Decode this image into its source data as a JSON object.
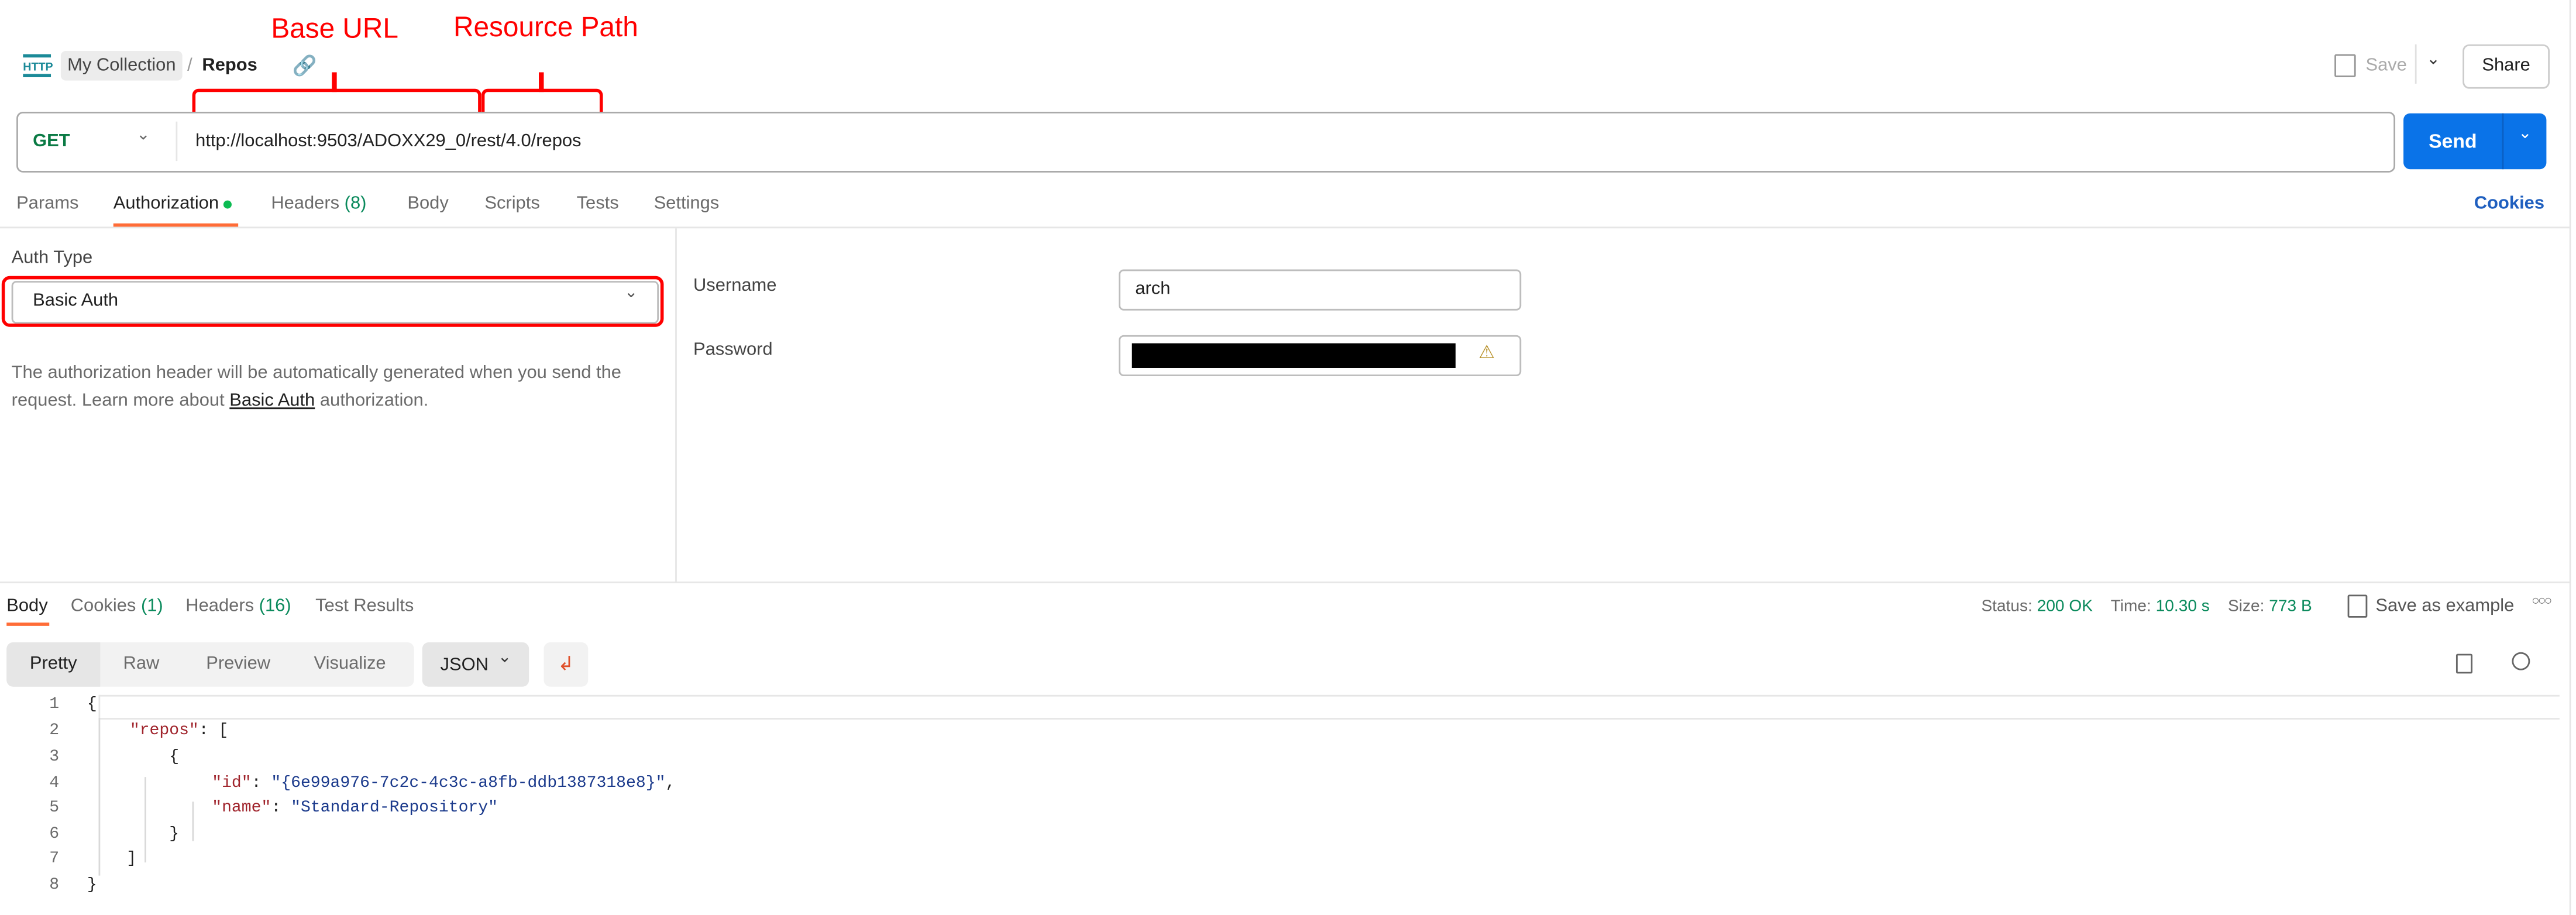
{
  "annotations": {
    "base_url": "Base URL",
    "resource_path": "Resource Path",
    "highlight_color": "#ff0000"
  },
  "header": {
    "icon": "http-icon",
    "collection": "My Collection",
    "separator": "/",
    "request_name": "Repos",
    "save_label": "Save",
    "share_label": "Share"
  },
  "request": {
    "method": "GET",
    "url": "http://localhost:9503/ADOXX29_0/rest/4.0/repos",
    "send_label": "Send",
    "send_color": "#0a73e8"
  },
  "request_tabs": [
    {
      "label": "Params"
    },
    {
      "label": "Authorization",
      "active": true
    },
    {
      "label": "Headers",
      "count": "(8)"
    },
    {
      "label": "Body"
    },
    {
      "label": "Scripts"
    },
    {
      "label": "Tests"
    },
    {
      "label": "Settings"
    }
  ],
  "cookies_link": "Cookies",
  "auth": {
    "type_label": "Auth Type",
    "type_value": "Basic Auth",
    "description_1": "The authorization header will be automatically generated when you send the",
    "description_2_pre": "request. Learn more about ",
    "description_link": "Basic Auth",
    "description_2_post": " authorization.",
    "username_label": "Username",
    "username_value": "arch",
    "password_label": "Password"
  },
  "response_tabs": [
    {
      "label": "Body",
      "active": true
    },
    {
      "label": "Cookies",
      "count": "(1)"
    },
    {
      "label": "Headers",
      "count": "(16)"
    },
    {
      "label": "Test Results"
    }
  ],
  "response_meta": {
    "status_label": "Status:",
    "status_value": "200 OK",
    "time_label": "Time:",
    "time_value": "10.30 s",
    "size_label": "Size:",
    "size_value": "773 B",
    "save_example": "Save as example"
  },
  "view_modes": [
    "Pretty",
    "Raw",
    "Preview",
    "Visualize"
  ],
  "format": "JSON",
  "code_lines": [
    {
      "n": "1",
      "text": "{"
    },
    {
      "n": "2",
      "key": "\"repos\"",
      "text": ": ["
    },
    {
      "n": "3",
      "text": "{"
    },
    {
      "n": "4",
      "key": "\"id\"",
      "sep": ": ",
      "val": "\"{6e99a976-7c2c-4c3c-a8fb-ddb1387318e8}\"",
      "text": ","
    },
    {
      "n": "5",
      "key": "\"name\"",
      "sep": ": ",
      "val": "\"Standard-Repository\"",
      "text": ""
    },
    {
      "n": "6",
      "text": "}"
    },
    {
      "n": "7",
      "text": "]"
    },
    {
      "n": "8",
      "text": "}"
    }
  ]
}
